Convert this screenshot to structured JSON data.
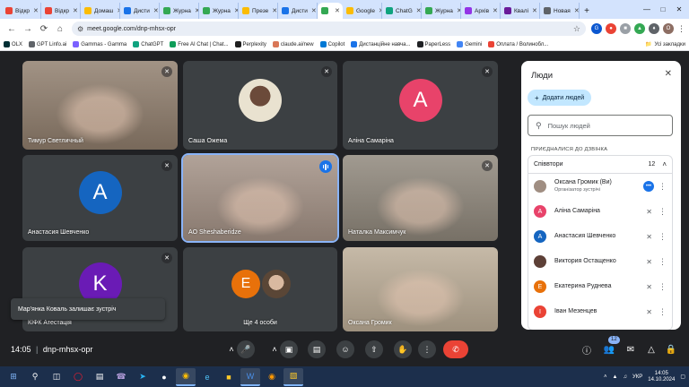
{
  "browser": {
    "tabs": [
      {
        "label": "Відкр",
        "color": "#ea4335"
      },
      {
        "label": "Відкр",
        "color": "#ea4335"
      },
      {
        "label": "Домаш",
        "color": "#fbbc04"
      },
      {
        "label": "Дисти",
        "color": "#1a73e8"
      },
      {
        "label": "Журна",
        "color": "#34a853"
      },
      {
        "label": "Журна",
        "color": "#34a853"
      },
      {
        "label": "Презе",
        "color": "#fbbc04"
      },
      {
        "label": "Дисти",
        "color": "#1a73e8"
      },
      {
        "label": "",
        "color": "#34a853",
        "active": true
      },
      {
        "label": "Google",
        "color": "#fbbc04"
      },
      {
        "label": "ChatG",
        "color": "#10a37f"
      },
      {
        "label": "Журна",
        "color": "#34a853"
      },
      {
        "label": "Архів",
        "color": "#9334e6"
      },
      {
        "label": "Квалі",
        "color": "#6a1b9a"
      },
      {
        "label": "Новая",
        "color": "#5f6368"
      }
    ],
    "url": "meet.google.com/dnp-mhsx-opr",
    "bookmarks": [
      {
        "label": "OLX",
        "color": "#002f34"
      },
      {
        "label": "GPT Linfo.ai",
        "color": "#5f6368"
      },
      {
        "label": "Gammas - Gamma",
        "color": "#7b61ff"
      },
      {
        "label": "ChatGPT",
        "color": "#10a37f"
      },
      {
        "label": "Free AI Chat | Chat...",
        "color": "#0f9d58"
      },
      {
        "label": "Perplexity",
        "color": "#1f1f1f"
      },
      {
        "label": "claude.ai/new",
        "color": "#d97757"
      },
      {
        "label": "Copilot",
        "color": "#0078d4"
      },
      {
        "label": "Дистанційне навча...",
        "color": "#1a73e8"
      },
      {
        "label": "PaperLess",
        "color": "#202124"
      },
      {
        "label": "Gemini",
        "color": "#4285f4"
      },
      {
        "label": "Оплата / Волинобл...",
        "color": "#ea4335"
      }
    ],
    "bookmarks_all": "Усі закладки"
  },
  "tiles": [
    {
      "name": "Тимур Светличный",
      "type": "video",
      "bg": "#8d7b6a",
      "mic_off": true
    },
    {
      "name": "Саша Ожема",
      "type": "avatar-photo",
      "bg": "#3c4043",
      "mic_off": true
    },
    {
      "name": "Аліна Самаріна",
      "type": "avatar",
      "letter": "A",
      "avatar_color": "#e8436a",
      "bg": "#3c4043",
      "mic_off": true
    },
    {
      "name": "Анастасия Шевченко",
      "type": "avatar",
      "letter": "A",
      "avatar_color": "#1565c0",
      "bg": "#3c4043",
      "mic_off": true
    },
    {
      "name": "AO Sheshaberidze",
      "type": "video",
      "bg": "#a08e82",
      "speaking": true
    },
    {
      "name": "Наталка Максимчук",
      "type": "video",
      "bg": "#8c8478",
      "mic_off": true
    },
    {
      "name": "КІФК Атестація",
      "type": "avatar",
      "letter": "K",
      "avatar_color": "#6a1bb5",
      "bg": "#3c4043",
      "mic_off": true
    },
    {
      "name": "Ще 4 особи",
      "type": "group",
      "letter": "E",
      "avatar_color": "#e8710a",
      "bg": "#3c4043"
    },
    {
      "name": "Оксана Громик",
      "type": "video",
      "bg": "#b9aa94"
    }
  ],
  "toast": "Мар'янка Коваль залишає зустріч",
  "controls": {
    "time": "14:05",
    "separator": "|",
    "meeting_code": "dnp-mhsx-opr",
    "people_badge": "12"
  },
  "people": {
    "title": "Люди",
    "add_label": "Додати людей",
    "search_placeholder": "Пошук людей",
    "section_label": "ПРИЄДНАЛИСЯ ДО ДЗВІНКА",
    "group_label": "Співвтори",
    "group_count": "12",
    "list": [
      {
        "name": "Оксана Громик (Ви)",
        "sub": "Організатор зустрічі",
        "letter": "",
        "color": "#a08e82"
      },
      {
        "name": "Аліна Самаріна",
        "letter": "A",
        "color": "#e8436a"
      },
      {
        "name": "Анастасия Шевченко",
        "letter": "A",
        "color": "#1565c0"
      },
      {
        "name": "Виктория Остащенко",
        "letter": "",
        "color": "#5d4037"
      },
      {
        "name": "Екатерина Руднева",
        "letter": "E",
        "color": "#e8710a"
      },
      {
        "name": "Іван Мезенцев",
        "letter": "I",
        "color": "#ea4335"
      }
    ]
  },
  "taskbar": {
    "lang": "УКР",
    "time": "14:05",
    "date": "14.10.2024"
  }
}
